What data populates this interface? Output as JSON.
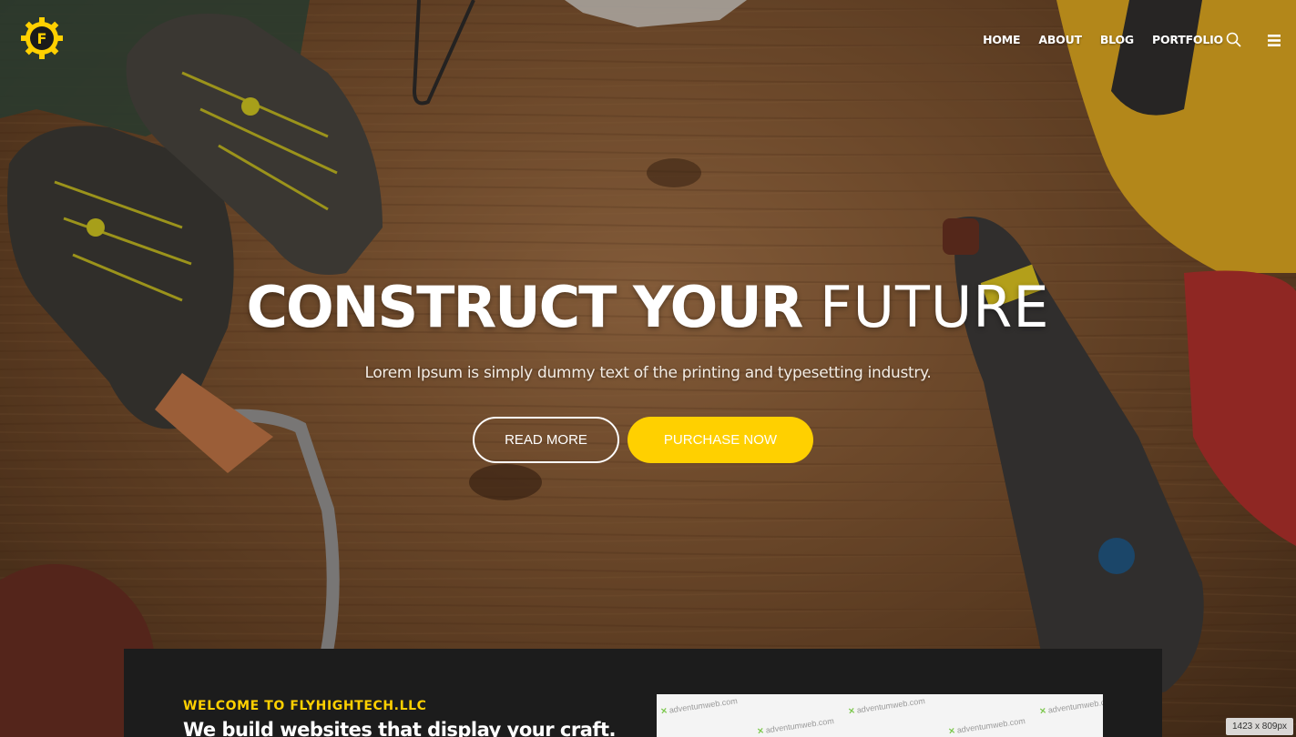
{
  "brand": {
    "logo_letter": "F",
    "accent": "#ffd000"
  },
  "nav": {
    "items": [
      "HOME",
      "ABOUT",
      "BLOG",
      "PORTFOLIO"
    ],
    "search_icon": "search-icon",
    "menu_icon": "hamburger-icon"
  },
  "hero": {
    "headline_bold": "CONSTRUCT YOUR",
    "headline_thin": "FUTURE",
    "subline": "Lorem Ipsum is simply dummy text of the printing and typesetting industry.",
    "read_more_label": "READ MORE",
    "purchase_label": "PURCHASE NOW"
  },
  "welcome": {
    "eyebrow": "WELCOME TO FLYHIGHTECH.LLC",
    "title": "We build websites that display your craft.",
    "watermark": "adventumweb.com"
  },
  "size_badge": "1423 x 809px",
  "colors": {
    "panel_bg": "#1c1c1c",
    "button_yellow": "#ffd000"
  }
}
